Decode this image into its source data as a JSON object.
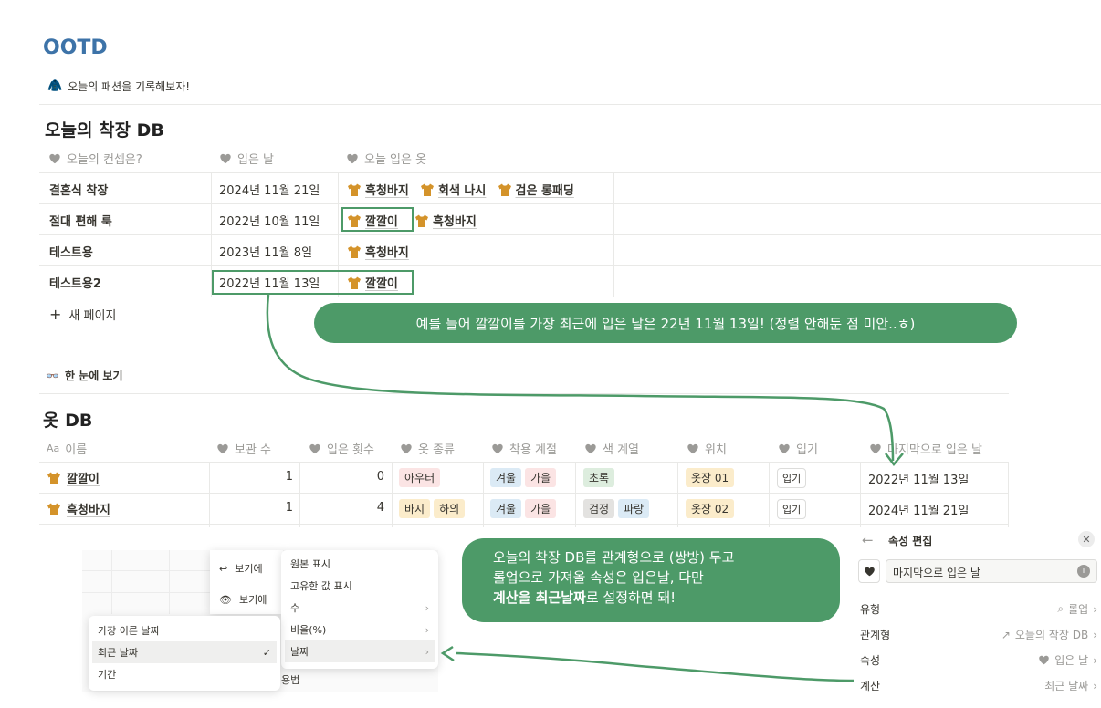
{
  "page": {
    "title": "OOTD",
    "subtitle": "오늘의 패션을 기록해보자!"
  },
  "db1": {
    "title": "오늘의 착장 DB",
    "headers": [
      "오늘의 컨셉은?",
      "입은 날",
      "오늘 입은 옷"
    ],
    "rows": [
      {
        "name": "결혼식 착장",
        "date": "2024년 11월 21일",
        "clothes": [
          "흑청바지",
          "회색 나시",
          "검은 롱패딩"
        ]
      },
      {
        "name": "절대 편해 룩",
        "date": "2022년 10월 11일",
        "clothes": [
          "깔깔이",
          "흑청바지"
        ]
      },
      {
        "name": "테스트용",
        "date": "2023년 11월 8일",
        "clothes": [
          "흑청바지"
        ]
      },
      {
        "name": "테스트용2",
        "date": "2022년 11월 13일",
        "clothes": [
          "깔깔이"
        ]
      }
    ],
    "new_page": "새 페이지"
  },
  "bubble1": "예를 들어 깔깔이를 가장 최근에 입은 날은 22년 11월 13일! (정렬 안해둔 점 미안..ㅎ)",
  "section2": "한 눈에 보기",
  "db2": {
    "title": "옷 DB",
    "headers": [
      "이름",
      "보관 수",
      "입은 횟수",
      "옷 종류",
      "착용 계절",
      "색 계열",
      "위치",
      "입기",
      "마지막으로 입은 날"
    ],
    "rows": [
      {
        "name": "깔깔이",
        "stock": "1",
        "worn": "0",
        "types": [
          "아우터"
        ],
        "seasons": [
          "겨울",
          "가을"
        ],
        "colors": [
          "초록"
        ],
        "loc": "옷장 01",
        "btn": "입기",
        "last": "2022년 11월 13일"
      },
      {
        "name": "흑청바지",
        "stock": "1",
        "worn": "4",
        "types": [
          "바지",
          "하의"
        ],
        "seasons": [
          "겨울",
          "가을"
        ],
        "colors": [
          "검정",
          "파랑"
        ],
        "loc": "옷장 02",
        "btn": "입기",
        "last": "2024년 11월 21일"
      }
    ]
  },
  "menu_left": {
    "items": [
      "보기에",
      "보기에"
    ]
  },
  "menu_right": {
    "items": [
      "원본 표시",
      "고유한 값 표시",
      "수",
      "비율(%)",
      "날짜"
    ]
  },
  "menu_date": {
    "items": [
      "가장 이른 날짜",
      "최근 날짜",
      "기간"
    ],
    "check": "✓"
  },
  "menu_bottom_text": "용법",
  "bubble2": {
    "line1": "오늘의 착장 DB를 관계형으로 (쌍방) 두고",
    "line2": "롤업으로 가져올 속성은 입은날, 다만",
    "line3_bold": "계산을 최근날짜",
    "line3_rest": "로 설정하면 돼!"
  },
  "prop_panel": {
    "title": "속성 편집",
    "name_value": "마지막으로 입은 날",
    "rows": [
      {
        "label": "유형",
        "value": "롤업"
      },
      {
        "label": "관계형",
        "value": "오늘의 착장 DB"
      },
      {
        "label": "속성",
        "value": "입은 날"
      },
      {
        "label": "계산",
        "value": "최근 날짜"
      }
    ]
  },
  "colors": {
    "accent": "#4d9a68",
    "title": "#3d73a8",
    "tshirt": "#d4932a"
  }
}
